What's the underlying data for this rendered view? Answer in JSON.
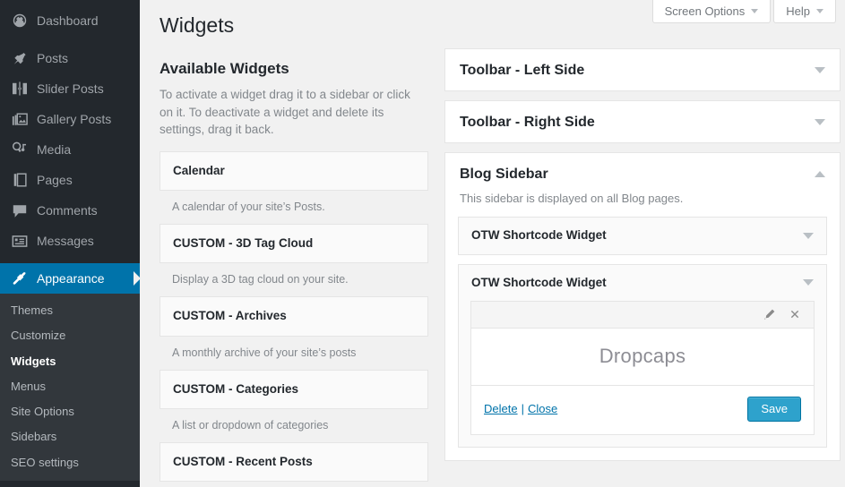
{
  "colors": {
    "admin_bg": "#23282d",
    "submenu_bg": "#32373c",
    "current_menu": "#0073aa",
    "accent_link": "#0073aa",
    "primary_button": "#2ea2cc",
    "page_bg": "#f1f1f1"
  },
  "sidebar": {
    "top_items": [
      {
        "label": "Dashboard",
        "icon": "dashboard-icon",
        "current": false
      },
      {
        "label": "Posts",
        "icon": "pin-icon",
        "current": false
      },
      {
        "label": "Slider Posts",
        "icon": "slider-icon",
        "current": false
      },
      {
        "label": "Gallery Posts",
        "icon": "gallery-icon",
        "current": false
      },
      {
        "label": "Media",
        "icon": "media-icon",
        "current": false
      },
      {
        "label": "Pages",
        "icon": "pages-icon",
        "current": false
      },
      {
        "label": "Comments",
        "icon": "comments-icon",
        "current": false
      },
      {
        "label": "Messages",
        "icon": "messages-icon",
        "current": false
      },
      {
        "label": "Appearance",
        "icon": "appearance-brush-icon",
        "current": true
      }
    ],
    "submenu": [
      {
        "label": "Themes",
        "current": false
      },
      {
        "label": "Customize",
        "current": false
      },
      {
        "label": "Widgets",
        "current": true
      },
      {
        "label": "Menus",
        "current": false
      },
      {
        "label": "Site Options",
        "current": false
      },
      {
        "label": "Sidebars",
        "current": false
      },
      {
        "label": "SEO settings",
        "current": false
      }
    ]
  },
  "screen_meta": {
    "screen_options_label": "Screen Options",
    "help_label": "Help"
  },
  "page": {
    "title": "Widgets"
  },
  "available": {
    "heading": "Available Widgets",
    "description": "To activate a widget drag it to a sidebar or click on it. To deactivate a widget and delete its settings, drag it back.",
    "widgets": [
      {
        "name": "Calendar",
        "description": "A calendar of your site’s Posts."
      },
      {
        "name": "CUSTOM - 3D Tag Cloud",
        "description": "Display a 3D tag cloud on your site."
      },
      {
        "name": "CUSTOM - Archives",
        "description": "A monthly archive of your site’s posts"
      },
      {
        "name": "CUSTOM - Categories",
        "description": "A list or dropdown of categories"
      },
      {
        "name": "CUSTOM - Recent Posts",
        "description": ""
      }
    ]
  },
  "sidebars": [
    {
      "title": "Toolbar - Left Side",
      "expanded": false,
      "toggle_icon": "chevron-down-icon",
      "description": "",
      "widgets": []
    },
    {
      "title": "Toolbar - Right Side",
      "expanded": false,
      "toggle_icon": "chevron-down-icon",
      "description": "",
      "widgets": []
    },
    {
      "title": "Blog Sidebar",
      "expanded": true,
      "toggle_icon": "chevron-up-icon",
      "description": "This sidebar is displayed on all Blog pages.",
      "widgets": [
        {
          "title": "OTW Shortcode Widget",
          "open": false,
          "toggle_icon": "chevron-down-icon"
        },
        {
          "title": "OTW Shortcode Widget",
          "open": true,
          "toggle_icon": "chevron-down-icon"
        }
      ]
    }
  ],
  "open_widget_form": {
    "edit_icon": "pencil-icon",
    "close_icon": "close-x-icon",
    "preview_text": "Dropcaps",
    "delete_label": "Delete",
    "separator": "|",
    "close_label": "Close",
    "save_label": "Save"
  }
}
